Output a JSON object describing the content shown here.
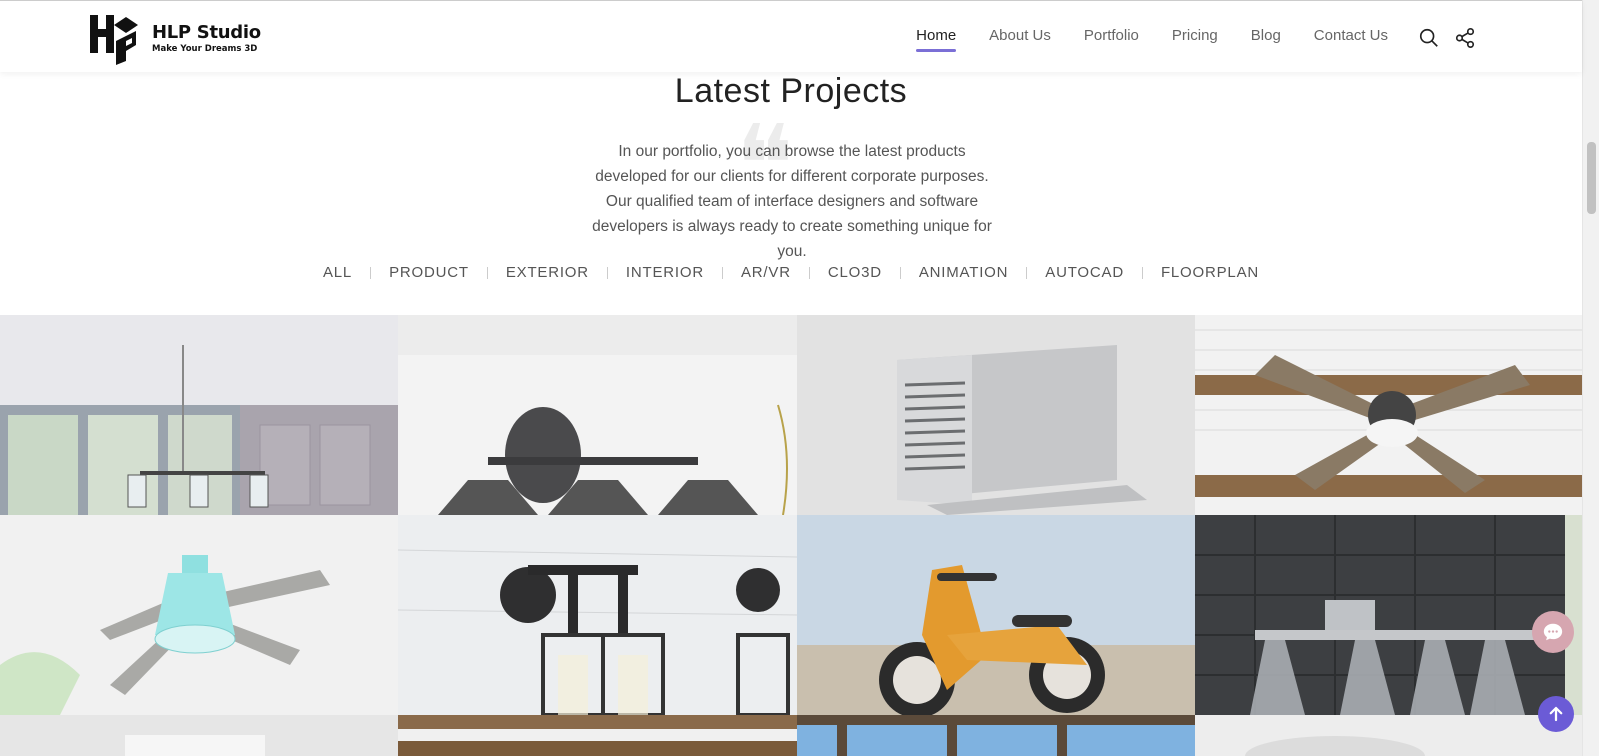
{
  "brand": {
    "name": "HLP Studio",
    "tagline": "Make Your Dreams 3D"
  },
  "nav": {
    "items": [
      {
        "label": "Home",
        "active": true
      },
      {
        "label": "About Us"
      },
      {
        "label": "Portfolio"
      },
      {
        "label": "Pricing"
      },
      {
        "label": "Blog"
      },
      {
        "label": "Contact Us"
      }
    ]
  },
  "section": {
    "title": "Latest Projects",
    "description": "In our portfolio, you can browse the latest products developed for our clients for different corporate purposes. Our qualified team of interface designers and software developers is always ready to create something unique for you."
  },
  "filters": [
    "ALL",
    "PRODUCT",
    "EXTERIOR",
    "INTERIOR",
    "AR/VR",
    "CLO3D",
    "ANIMATION",
    "AUTOCAD",
    "FLOORPLAN"
  ],
  "colors": {
    "accent": "#7b6fd6",
    "chat": "#d6a6b0",
    "scroll_top": "#6b5bd6"
  },
  "icons": {
    "search": "search-icon",
    "share": "share-icon",
    "chat": "chat-icon",
    "up": "arrow-up-icon"
  }
}
